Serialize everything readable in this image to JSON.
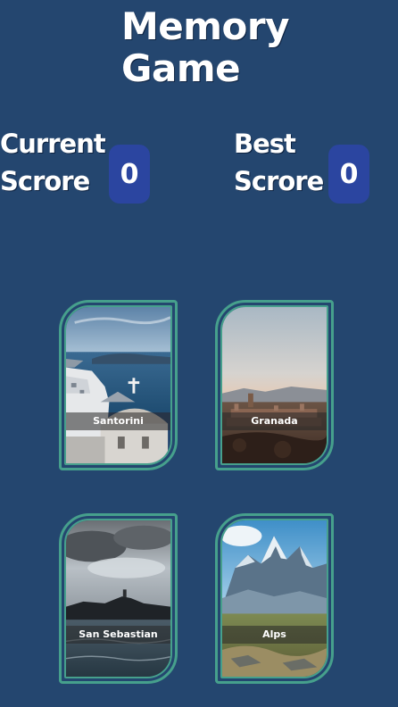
{
  "header": {
    "title": "Memory Game"
  },
  "scores": {
    "current_label": "Current Scrore",
    "current_value": "0",
    "best_label": "Best Scrore",
    "best_value": "0"
  },
  "cards": [
    {
      "label": "Santorini"
    },
    {
      "label": "Granada"
    },
    {
      "label": "San Sebastian"
    },
    {
      "label": "Alps"
    }
  ],
  "colors": {
    "background": "#24466f",
    "score_box": "#2b45a0",
    "card_border": "#46a08c"
  }
}
